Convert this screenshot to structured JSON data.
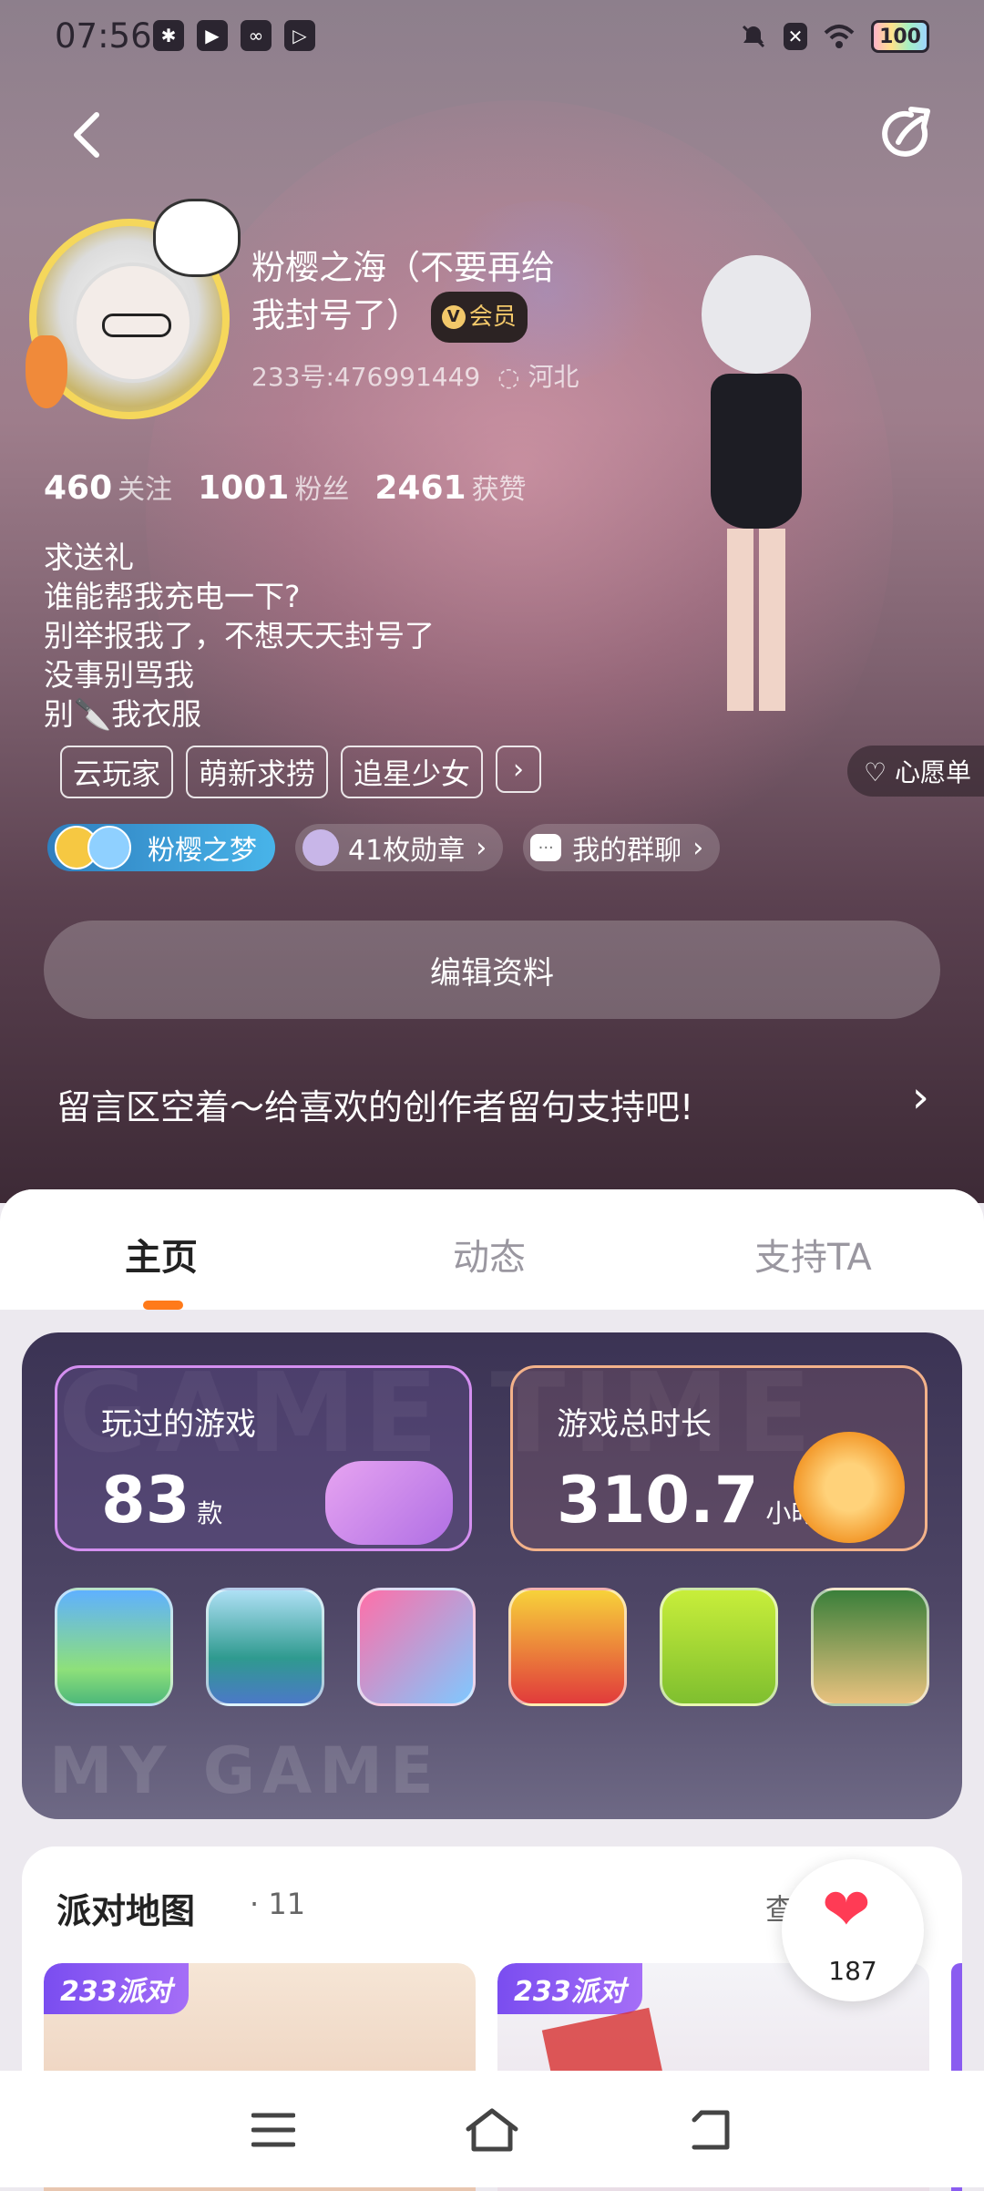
{
  "status_bar": {
    "time": "07:56",
    "battery": "100",
    "left_icons": [
      "paw-icon",
      "play-icon",
      "link-icon",
      "video-icon"
    ],
    "right_icons": [
      "mute-icon",
      "sim-x-icon",
      "wifi-icon",
      "battery-icon"
    ]
  },
  "profile": {
    "name_line1": "粉樱之海（不要再给",
    "name_line2": "我封号了）",
    "vip_label": "会员",
    "uid": "233号:476991449",
    "location": "河北",
    "stats": [
      {
        "num": "460",
        "label": "关注"
      },
      {
        "num": "1001",
        "label": "粉丝"
      },
      {
        "num": "2461",
        "label": "获赞"
      }
    ],
    "bio": [
      "求送礼",
      "谁能帮我充电一下?",
      "别举报我了，不想天天封号了",
      "没事别骂我",
      "别🔪我衣服"
    ],
    "tags": [
      "云玩家",
      "萌新求捞",
      "追星少女"
    ],
    "tag_more": "›",
    "wish_label": "心愿单",
    "friend_pill": "粉樱之梦",
    "medals": "41枚勋章",
    "group_chat": "我的群聊",
    "edit_button": "编辑资料",
    "message_prompt": "留言区空着～给喜欢的创作者留句支持吧!"
  },
  "tabs": [
    "主页",
    "动态",
    "支持TA"
  ],
  "game_card": {
    "bg_text_top": "GAME TIME",
    "bg_text_bottom": "MY GAME",
    "played_title": "玩过的游戏",
    "played_value": "83",
    "played_unit": "款",
    "time_title": "游戏总时长",
    "time_value": "310.7",
    "time_unit": "小时"
  },
  "party": {
    "title": "派对地图",
    "count": "· 11",
    "more": "查",
    "badge": "233派对"
  },
  "like_count": "187",
  "colors": {
    "accent": "#ff7a1a",
    "vip_gold": "#f2c86a",
    "party_purple": "#7a4df0",
    "heart": "#ff3b55"
  }
}
